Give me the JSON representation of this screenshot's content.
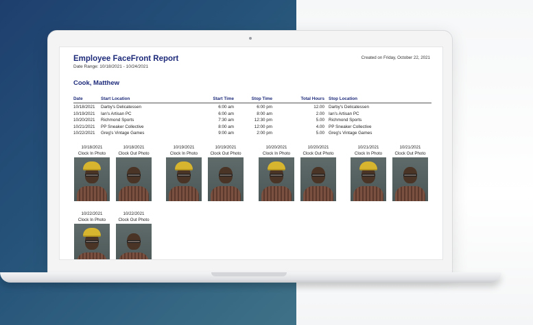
{
  "report": {
    "title": "Employee FaceFront Report",
    "date_range": "Date Range: 10/18/2021 - 10/24/2021",
    "created": "Created on Friday, October 22, 2021",
    "employee_name": "Cook, Matthew"
  },
  "table": {
    "headers": [
      "Date",
      "Start Location",
      "Start Time",
      "Stop Time",
      "Total Hours",
      "Stop Location"
    ],
    "rows": [
      [
        "10/18/2021",
        "Darby's Delicatessen",
        "6:00 am",
        "6:00 pm",
        "12.00",
        "Darby's Delicatessen"
      ],
      [
        "10/19/2021",
        "Ian's Artisan PC",
        "6:00 am",
        "8:00 am",
        "2.00",
        "Ian's Artisan PC"
      ],
      [
        "10/20/2021",
        "Richmond Sports",
        "7:30 am",
        "12:30 pm",
        "5.00",
        "Richmond Sports"
      ],
      [
        "10/21/2021",
        "PP Sneaker Collective",
        "8:00 am",
        "12:00 pm",
        "4.00",
        "PP Sneaker Collective"
      ],
      [
        "10/22/2021",
        "Greg's Vintage Games",
        "9:00 am",
        "2:00 pm",
        "5.00",
        "Greg's Vintage Games"
      ]
    ]
  },
  "photos": {
    "clock_in_label": "Clock In Photo",
    "clock_out_label": "Clock Out Photo",
    "entries": [
      {
        "date": "10/18/2021",
        "type": "in"
      },
      {
        "date": "10/18/2021",
        "type": "out"
      },
      {
        "date": "10/19/2021",
        "type": "in"
      },
      {
        "date": "10/19/2021",
        "type": "out"
      },
      {
        "date": "10/20/2021",
        "type": "in"
      },
      {
        "date": "10/20/2021",
        "type": "out"
      },
      {
        "date": "10/21/2021",
        "type": "in"
      },
      {
        "date": "10/21/2021",
        "type": "out"
      },
      {
        "date": "10/22/2021",
        "type": "in"
      },
      {
        "date": "10/22/2021",
        "type": "out"
      }
    ]
  },
  "colors": {
    "title_navy": "#1d2a7a",
    "background_blue": "#26547a",
    "hard_hat_yellow": "#d7b52f"
  }
}
